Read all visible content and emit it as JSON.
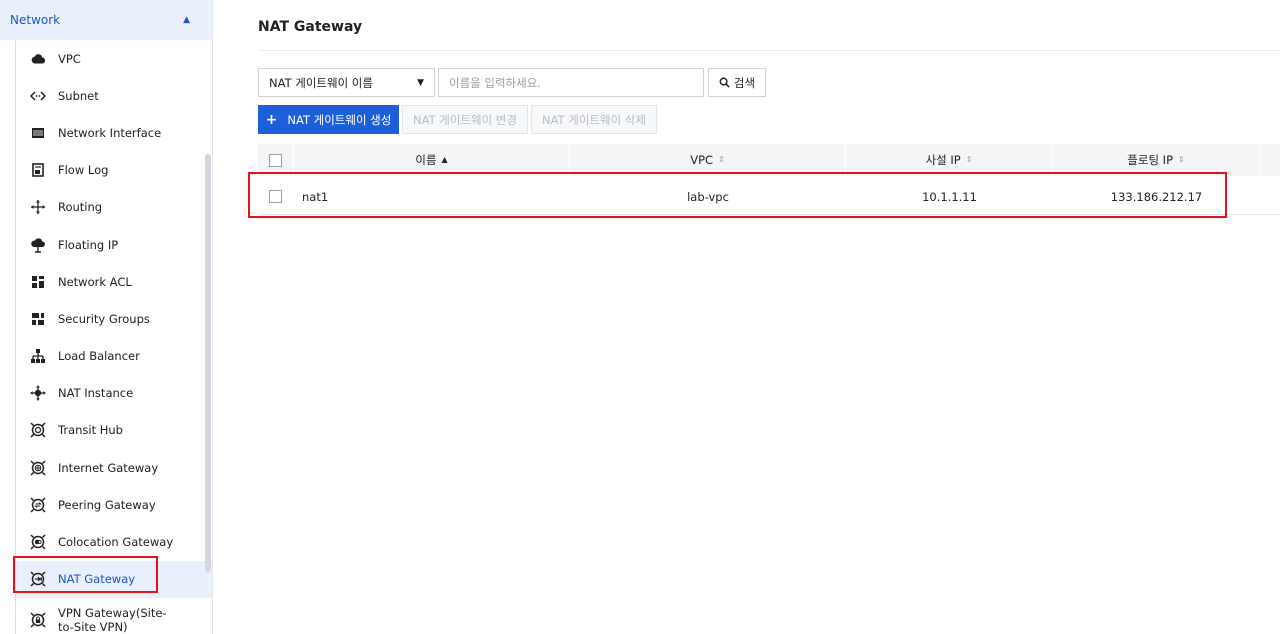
{
  "sidebar": {
    "section_label": "Network",
    "items": [
      {
        "label": "VPC",
        "icon": "cloud-icon"
      },
      {
        "label": "Subnet",
        "icon": "code-arrows-icon"
      },
      {
        "label": "Network Interface",
        "icon": "nic-card-icon"
      },
      {
        "label": "Flow Log",
        "icon": "log-file-icon"
      },
      {
        "label": "Routing",
        "icon": "move-arrows-icon"
      },
      {
        "label": "Floating IP",
        "icon": "cloud-tree-icon"
      },
      {
        "label": "Network ACL",
        "icon": "acl-grid-icon"
      },
      {
        "label": "Security Groups",
        "icon": "security-grid-icon"
      },
      {
        "label": "Load Balancer",
        "icon": "hierarchy-icon"
      },
      {
        "label": "NAT Instance",
        "icon": "nat-instance-icon"
      },
      {
        "label": "Transit Hub",
        "icon": "gateway-icon"
      },
      {
        "label": "Internet Gateway",
        "icon": "globe-gateway-icon"
      },
      {
        "label": "Peering Gateway",
        "icon": "peering-gateway-icon"
      },
      {
        "label": "Colocation Gateway",
        "icon": "colocation-gateway-icon"
      },
      {
        "label": "NAT Gateway",
        "icon": "nat-gateway-icon"
      },
      {
        "label": "VPN Gateway(Site-to-Site VPN)",
        "icon": "vpn-gateway-icon"
      }
    ],
    "active_item": "NAT Gateway"
  },
  "main": {
    "title": "NAT Gateway",
    "filter": {
      "select_value": "NAT 게이트웨이 이름",
      "input_placeholder": "이름을 입력하세요.",
      "search_label": "검색"
    },
    "actions": {
      "create_label": "NAT 게이트웨이 생성",
      "edit_label": "NAT 게이트웨이 변경",
      "delete_label": "NAT 게이트웨이 삭제"
    },
    "table": {
      "columns": [
        "이름",
        "VPC",
        "사설 IP",
        "플로팅 IP"
      ],
      "rows": [
        {
          "name": "nat1",
          "vpc": "lab-vpc",
          "private_ip": "10.1.1.11",
          "floating_ip": "133.186.212.17"
        }
      ]
    }
  },
  "colors": {
    "accent": "#1c5fd8",
    "active_bg": "#e9f0fb",
    "highlight_border": "#e0141a"
  }
}
